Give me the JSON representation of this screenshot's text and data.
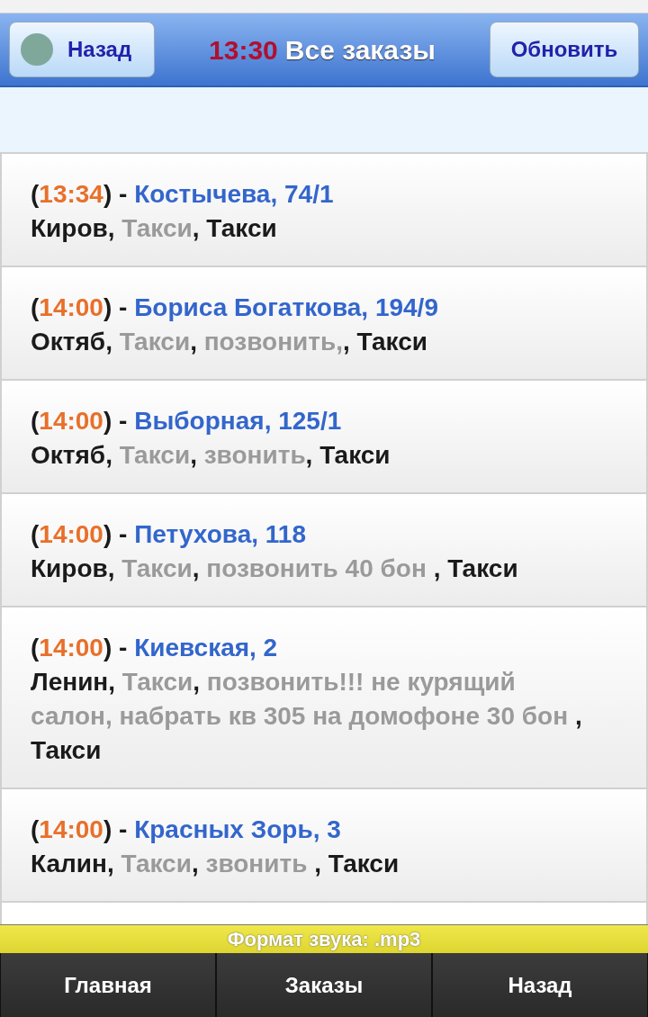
{
  "header": {
    "back_button": "Назад",
    "time": "13:30",
    "title": "Все заказы",
    "refresh_button": "Обновить"
  },
  "orders": [
    {
      "title": [
        {
          "text": "(",
          "kind": "plain"
        },
        {
          "text": "13:34",
          "kind": "time"
        },
        {
          "text": ") - ",
          "kind": "plain"
        },
        {
          "text": "Костычева, 74/1",
          "kind": "link"
        }
      ],
      "details": [
        {
          "text": "Киров, ",
          "kind": "plain"
        },
        {
          "text": "Такси",
          "kind": "muted"
        },
        {
          "text": ", Такси",
          "kind": "plain"
        }
      ]
    },
    {
      "title": [
        {
          "text": "(",
          "kind": "plain"
        },
        {
          "text": "14:00",
          "kind": "time"
        },
        {
          "text": ") - ",
          "kind": "plain"
        },
        {
          "text": "Бориса Богаткова, 194/9",
          "kind": "link"
        }
      ],
      "details": [
        {
          "text": "Октяб, ",
          "kind": "plain"
        },
        {
          "text": "Такси",
          "kind": "muted"
        },
        {
          "text": ", ",
          "kind": "plain"
        },
        {
          "text": "позвонить,",
          "kind": "muted"
        },
        {
          "text": ", Такси",
          "kind": "plain"
        }
      ]
    },
    {
      "title": [
        {
          "text": "(",
          "kind": "plain"
        },
        {
          "text": "14:00",
          "kind": "time"
        },
        {
          "text": ") - ",
          "kind": "plain"
        },
        {
          "text": "Выборная, 125/1",
          "kind": "link"
        }
      ],
      "details": [
        {
          "text": "Октяб, ",
          "kind": "plain"
        },
        {
          "text": "Такси",
          "kind": "muted"
        },
        {
          "text": ", ",
          "kind": "plain"
        },
        {
          "text": "звонить",
          "kind": "muted"
        },
        {
          "text": ", Такси",
          "kind": "plain"
        }
      ]
    },
    {
      "title": [
        {
          "text": "(",
          "kind": "plain"
        },
        {
          "text": "14:00",
          "kind": "time"
        },
        {
          "text": ") - ",
          "kind": "plain"
        },
        {
          "text": "Петухова, 118",
          "kind": "link"
        }
      ],
      "details": [
        {
          "text": "Киров, ",
          "kind": "plain"
        },
        {
          "text": "Такси",
          "kind": "muted"
        },
        {
          "text": ", ",
          "kind": "plain"
        },
        {
          "text": "позвонить 40 бон ",
          "kind": "muted"
        },
        {
          "text": ", Такси",
          "kind": "plain"
        }
      ]
    },
    {
      "title": [
        {
          "text": "(",
          "kind": "plain"
        },
        {
          "text": "14:00",
          "kind": "time"
        },
        {
          "text": ") - ",
          "kind": "plain"
        },
        {
          "text": "Киевская, 2",
          "kind": "link"
        }
      ],
      "details": [
        {
          "text": "Ленин, ",
          "kind": "plain"
        },
        {
          "text": "Такси",
          "kind": "muted"
        },
        {
          "text": ", ",
          "kind": "plain"
        },
        {
          "text": "позвонить!!! не курящий салон, набрать кв 305 на домофоне 30 бон ",
          "kind": "muted"
        },
        {
          "text": ", Такси",
          "kind": "plain"
        }
      ]
    },
    {
      "title": [
        {
          "text": "(",
          "kind": "plain"
        },
        {
          "text": "14:00",
          "kind": "time"
        },
        {
          "text": ") - ",
          "kind": "plain"
        },
        {
          "text": "Красных Зорь, 3",
          "kind": "link"
        }
      ],
      "details": [
        {
          "text": "Калин, ",
          "kind": "plain"
        },
        {
          "text": "Такси",
          "kind": "muted"
        },
        {
          "text": ", ",
          "kind": "plain"
        },
        {
          "text": "звонить ",
          "kind": "muted"
        },
        {
          "text": ", Такси",
          "kind": "plain"
        }
      ]
    }
  ],
  "sound_format": "Формат звука: .mp3",
  "nav": [
    {
      "label": "Главная"
    },
    {
      "label": "Заказы"
    },
    {
      "label": "Назад"
    }
  ]
}
